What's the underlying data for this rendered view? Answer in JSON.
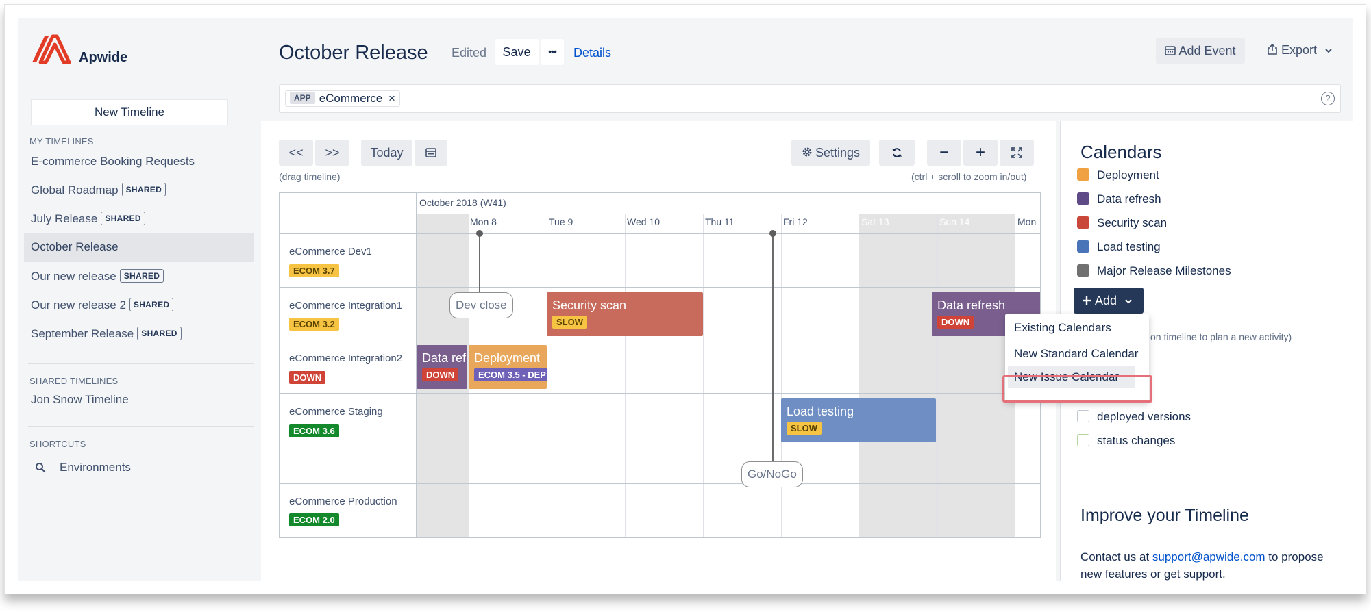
{
  "brand": {
    "name": "Apwide"
  },
  "sidebar": {
    "new_timeline_label": "New Timeline",
    "my_timelines_heading": "MY TIMELINES",
    "my_timelines": [
      {
        "label": "E-commerce Booking Requests",
        "shared": "",
        "active": false
      },
      {
        "label": "Global Roadmap",
        "shared": "SHARED",
        "active": false
      },
      {
        "label": "July Release",
        "shared": "SHARED",
        "active": false
      },
      {
        "label": "October Release",
        "shared": "",
        "active": true
      },
      {
        "label": "Our new release",
        "shared": "SHARED",
        "active": false
      },
      {
        "label": "Our new release 2",
        "shared": "SHARED",
        "active": false
      },
      {
        "label": "September Release",
        "shared": "SHARED",
        "active": false
      }
    ],
    "shared_heading": "SHARED TIMELINES",
    "shared_timelines": [
      {
        "label": "Jon Snow Timeline"
      }
    ],
    "shortcuts_heading": "SHORTCUTS",
    "shortcuts": [
      {
        "label": "Environments",
        "icon": "search-icon"
      }
    ]
  },
  "header": {
    "title": "October Release",
    "edited": "Edited",
    "save_label": "Save",
    "more_label": "•••",
    "details_label": "Details",
    "add_event_label": "Add Event",
    "export_label": "Export"
  },
  "filter": {
    "chip_tag": "APP",
    "chip_label": "eCommerce",
    "chip_remove": "×",
    "help": "?"
  },
  "toolbar": {
    "prev_label": "<<",
    "next_label": ">>",
    "today_label": "Today",
    "settings_label": "Settings",
    "zoom_out_label": "−",
    "zoom_in_label": "+",
    "drag_hint": "(drag timeline)",
    "zoom_hint": "(ctrl + scroll to zoom in/out)"
  },
  "timeline": {
    "week_label": "October 2018 (W41)",
    "days": [
      "Mon 8",
      "Tue 9",
      "Wed 10",
      "Thu 11",
      "Fri 12",
      "Sat 13",
      "Sun 14",
      "Mon"
    ],
    "rows": [
      {
        "name": "eCommerce Dev1",
        "badge": "ECOM 3.7",
        "badge_bg": "#f6c342",
        "badge_fg": "#594300"
      },
      {
        "name": "eCommerce Integration1",
        "badge": "ECOM 3.2",
        "badge_bg": "#f6c342",
        "badge_fg": "#594300"
      },
      {
        "name": "eCommerce Integration2",
        "badge": "DOWN",
        "badge_bg": "#d04437",
        "badge_fg": "#ffffff"
      },
      {
        "name": "eCommerce Staging",
        "badge": "ECOM 3.6",
        "badge_bg": "#14892c",
        "badge_fg": "#ffffff"
      },
      {
        "name": "eCommerce Production",
        "badge": "ECOM 2.0",
        "badge_bg": "#14892c",
        "badge_fg": "#ffffff"
      }
    ],
    "events": [
      {
        "title": "Security scan",
        "badge": "SLOW",
        "color": "#c86b5c",
        "badge_bg": "#f6c342",
        "badge_fg": "#594300"
      },
      {
        "title": "Data refresh",
        "badge": "DOWN",
        "color": "#7a5f8e",
        "badge_bg": "#d04437",
        "badge_fg": "#ffffff"
      },
      {
        "title": "Data refr",
        "badge": "DOWN",
        "color": "#7a5f8e",
        "badge_bg": "#d04437",
        "badge_fg": "#ffffff"
      },
      {
        "title": "Deployment",
        "badge": "ECOM 3.5 - DEP",
        "color": "#e8a75a",
        "badge_bg": "#6f61b8",
        "badge_fg": "#ffffff"
      },
      {
        "title": "Load testing",
        "badge": "SLOW",
        "color": "#6f8fc4",
        "badge_bg": "#f6c342",
        "badge_fg": "#594300"
      }
    ],
    "milestones": [
      {
        "label": "Dev close"
      },
      {
        "label": "Go/NoGo"
      }
    ]
  },
  "calendars": {
    "title": "Calendars",
    "items": [
      {
        "label": "Deployment",
        "color": "#f0a142"
      },
      {
        "label": "Data refresh",
        "color": "#5e4a87"
      },
      {
        "label": "Security scan",
        "color": "#c9473a"
      },
      {
        "label": "Load testing",
        "color": "#4a74b8"
      },
      {
        "label": "Major Release Milestones",
        "color": "#707070"
      }
    ],
    "add_label": "Add",
    "plan_hint": "on timeline to plan a new activity)",
    "menu": [
      "Existing Calendars",
      "New Standard Calendar",
      "New Issue Calendar"
    ],
    "checkboxes": [
      "deployed versions",
      "status changes"
    ]
  },
  "improve": {
    "title": "Improve your Timeline",
    "text_before": "Contact us at ",
    "email": "support@apwide.com",
    "text_after": " to propose new features or get support."
  }
}
